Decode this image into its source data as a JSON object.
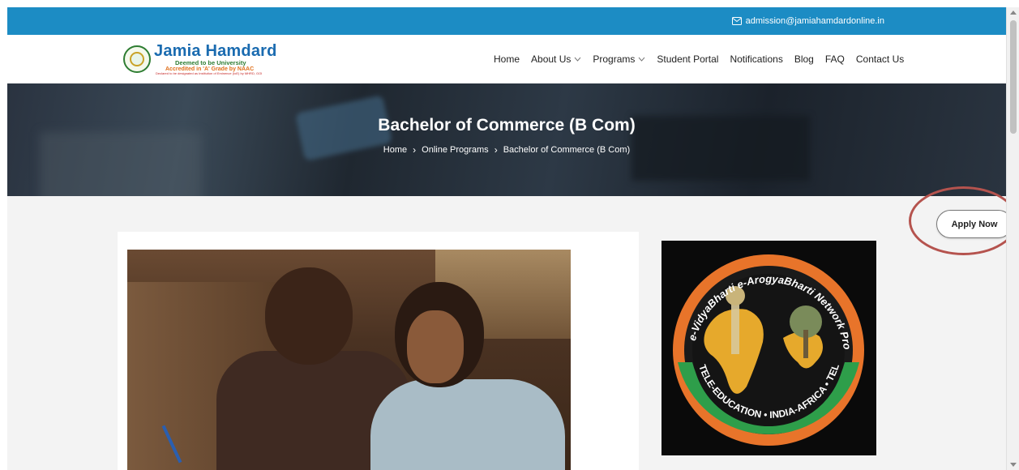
{
  "topbar": {
    "email": "admission@jamiahamdardonline.in",
    "icon": "mail-icon",
    "bg_color": "#1c8cc4"
  },
  "logo": {
    "brand": "Jamia Hamdard",
    "line1": "Deemed to be University",
    "line2": "Accredited in 'A' Grade by NAAC",
    "line3": "Declared to be designated as Institution of Eminence (IoE) by MHRD, GOI"
  },
  "nav": {
    "items": [
      {
        "label": "Home",
        "dropdown": false
      },
      {
        "label": "About Us",
        "dropdown": true
      },
      {
        "label": "Programs",
        "dropdown": true
      },
      {
        "label": "Student Portal",
        "dropdown": false
      },
      {
        "label": "Notifications",
        "dropdown": false
      },
      {
        "label": "Blog",
        "dropdown": false
      },
      {
        "label": "FAQ",
        "dropdown": false
      },
      {
        "label": "Contact Us",
        "dropdown": false
      }
    ]
  },
  "hero": {
    "title": "Bachelor of Commerce (B Com)",
    "breadcrumb": [
      "Home",
      "Online Programs",
      "Bachelor of Commerce (B Com)"
    ],
    "separator": "›"
  },
  "apply": {
    "label": "Apply Now",
    "highlight_color": "#b5534e"
  },
  "emblem": {
    "top_text": "e-VidyaBharti e-ArogyaBharti Network Project",
    "bottom_text": "TELE-EDUCATION • INDIA-AFRICA • TELE-MEDICINE"
  }
}
